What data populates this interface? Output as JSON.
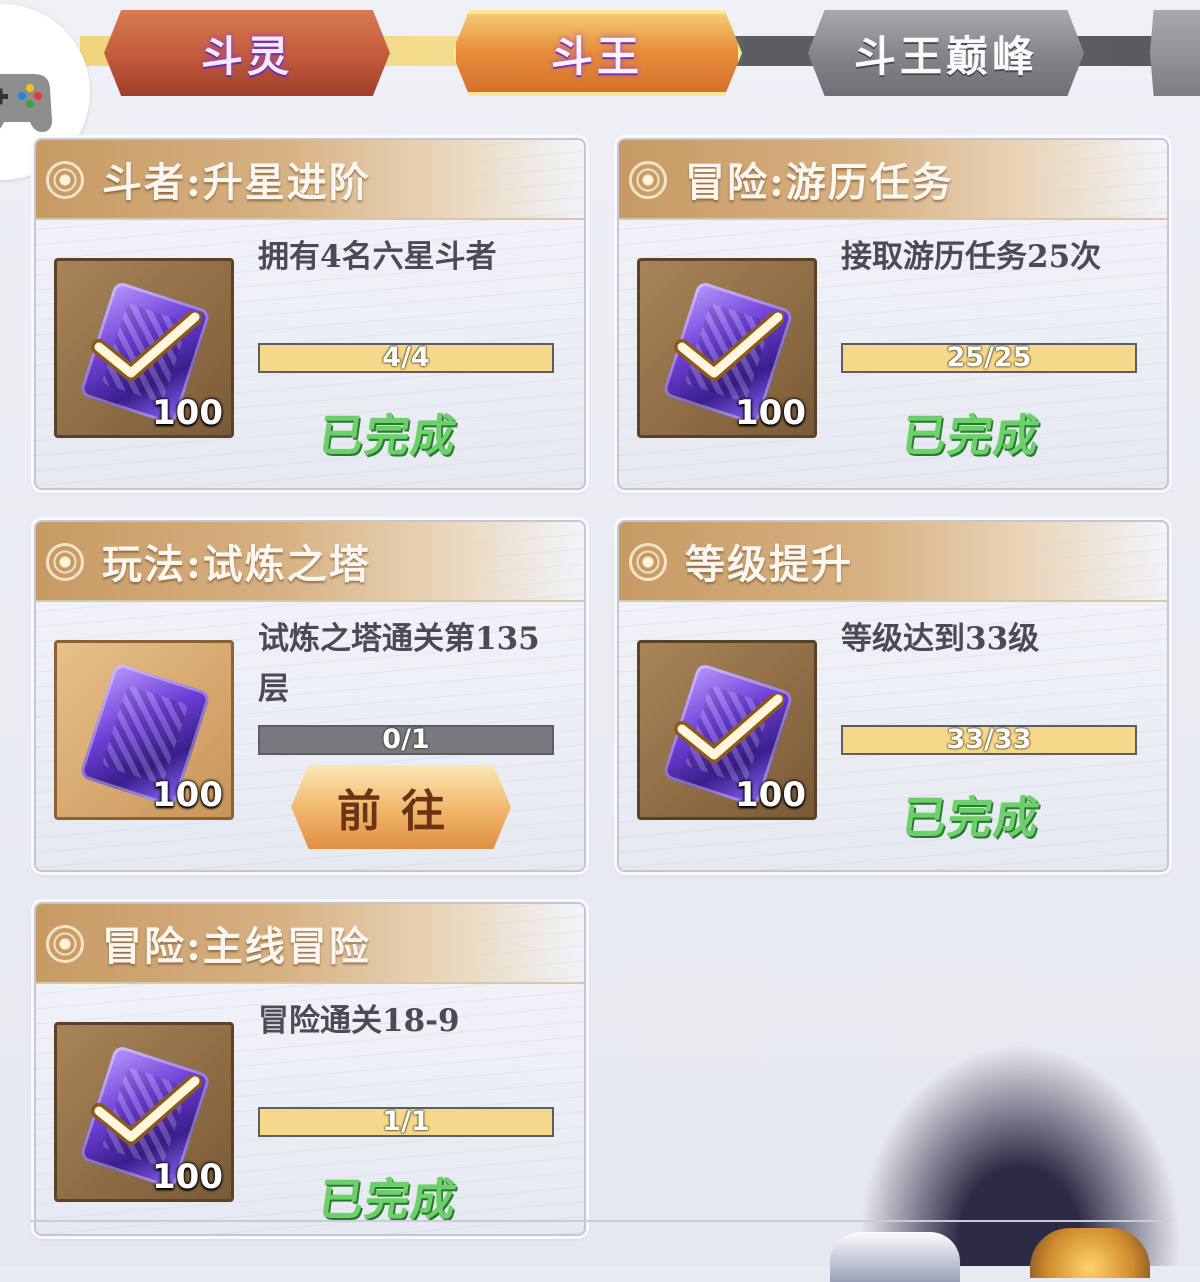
{
  "tabs": [
    {
      "label": "斗灵",
      "state": "default"
    },
    {
      "label": "斗王",
      "state": "selected"
    },
    {
      "label": "斗王巅峰",
      "state": "locked"
    }
  ],
  "tasks": [
    {
      "title": "斗者:升星进阶",
      "description": "拥有4名六星斗者",
      "progress_text": "4/4",
      "progress_value": 1.0,
      "reward_qty": "100",
      "status": "已完成",
      "claimed": true
    },
    {
      "title": "冒险:游历任务",
      "description": "接取游历任务25次",
      "progress_text": "25/25",
      "progress_value": 1.0,
      "reward_qty": "100",
      "status": "已完成",
      "claimed": true
    },
    {
      "title": "玩法:试炼之塔",
      "description": "试炼之塔通关第135层",
      "progress_text": "0/1",
      "progress_value": 0.0,
      "reward_qty": "100",
      "action_label": "前往",
      "claimed": false
    },
    {
      "title": "等级提升",
      "description": "等级达到33级",
      "progress_text": "33/33",
      "progress_value": 1.0,
      "reward_qty": "100",
      "status": "已完成",
      "claimed": true
    },
    {
      "title": "冒险:主线冒险",
      "description": "冒险通关18-9",
      "progress_text": "1/1",
      "progress_value": 1.0,
      "reward_qty": "100",
      "status": "已完成",
      "claimed": true
    }
  ],
  "icons": {
    "gamepad": "gamepad-icon",
    "task_emblem": "task-emblem-icon",
    "reward_gem": "purple-gem-icon",
    "claimed_check": "checkmark-icon"
  },
  "colors": {
    "done_green": "#6cd06b",
    "progress_fill": "#f6d88a",
    "header_gold": "#c79a64"
  }
}
